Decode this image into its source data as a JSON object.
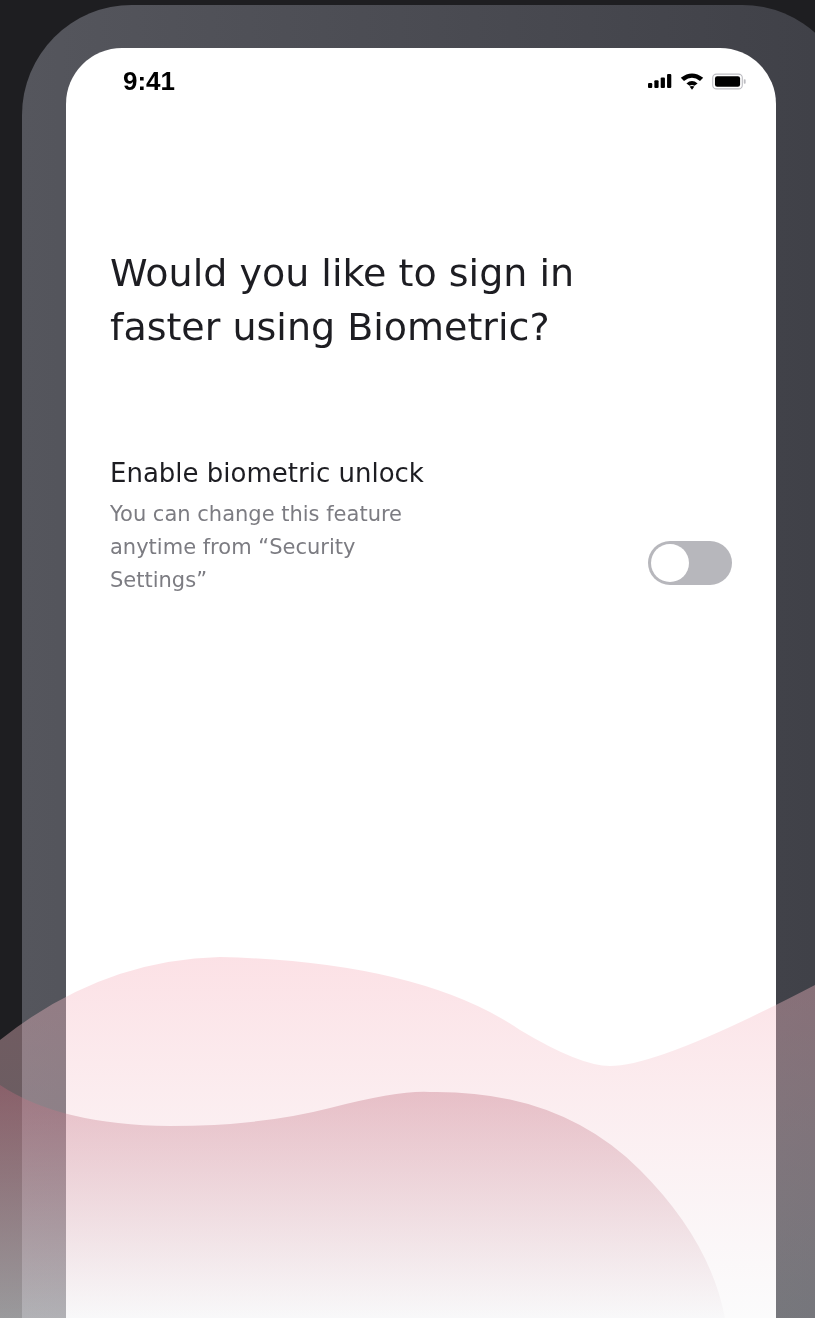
{
  "status_bar": {
    "time": "9:41"
  },
  "heading": "Would you like to sign in faster using Biometric?",
  "setting": {
    "label": "Enable biometric unlock",
    "description": "You can change this feature anytime from “Security Settings”",
    "on": false
  }
}
